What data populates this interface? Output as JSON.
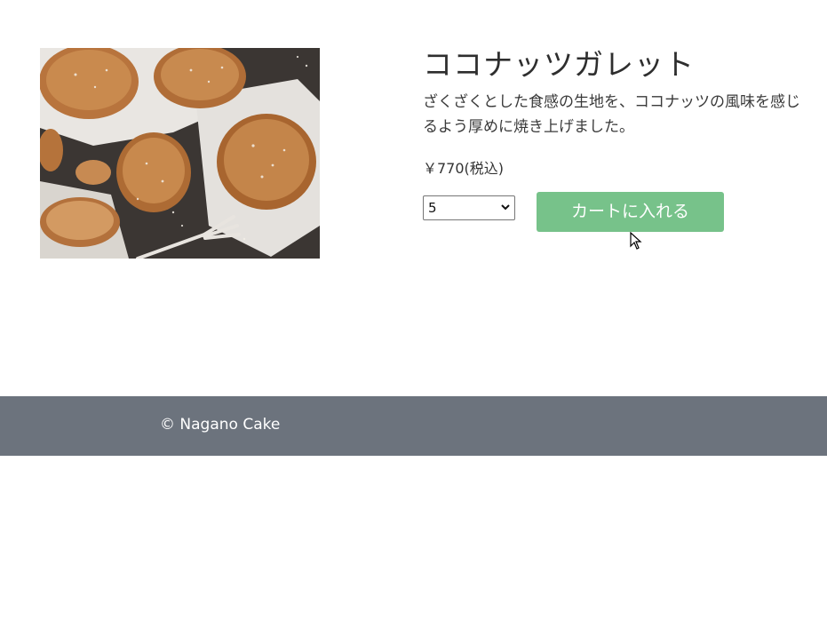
{
  "product": {
    "image_alt": "coconut galette cookies",
    "name": "ココナッツガレット",
    "description": "ざくざくとした食感の生地を、ココナッツの風味を感じるよう厚めに焼き上げました。",
    "price": "￥770(税込)"
  },
  "order": {
    "quantity_selected": "5",
    "add_to_cart_label": "カートに入れる",
    "button_color": "#77c28a"
  },
  "footer": {
    "copyright": "© Nagano Cake",
    "background_color": "#6c737d"
  },
  "icons": {
    "dropdown": "chevron-down-icon",
    "cursor": "mouse-pointer-icon"
  }
}
